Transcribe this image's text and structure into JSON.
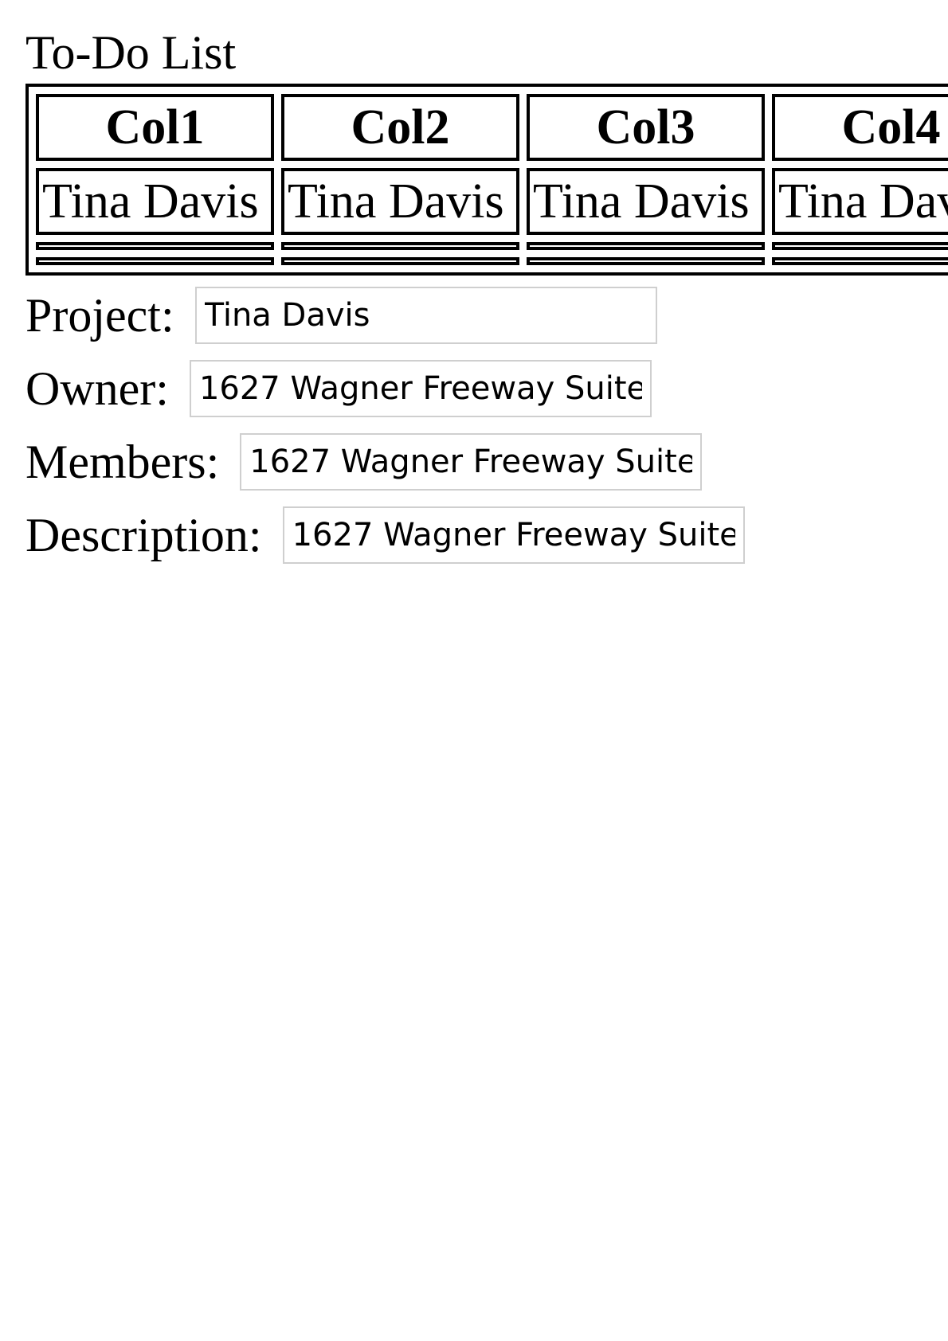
{
  "title": "To-Do List",
  "table": {
    "headers": [
      "Col1",
      "Col2",
      "Col3",
      "Col4"
    ],
    "rows": [
      [
        "Tina Davis",
        "Tina Davis",
        "Tina Davis",
        "Tina Davis"
      ]
    ]
  },
  "fields": {
    "project": {
      "label": "Project:",
      "value": "Tina Davis"
    },
    "owner": {
      "label": "Owner:",
      "value": "1627 Wagner Freeway Suite"
    },
    "members": {
      "label": "Members:",
      "value": "1627 Wagner Freeway Suite"
    },
    "description": {
      "label": "Description:",
      "value": "1627 Wagner Freeway Suite"
    }
  }
}
